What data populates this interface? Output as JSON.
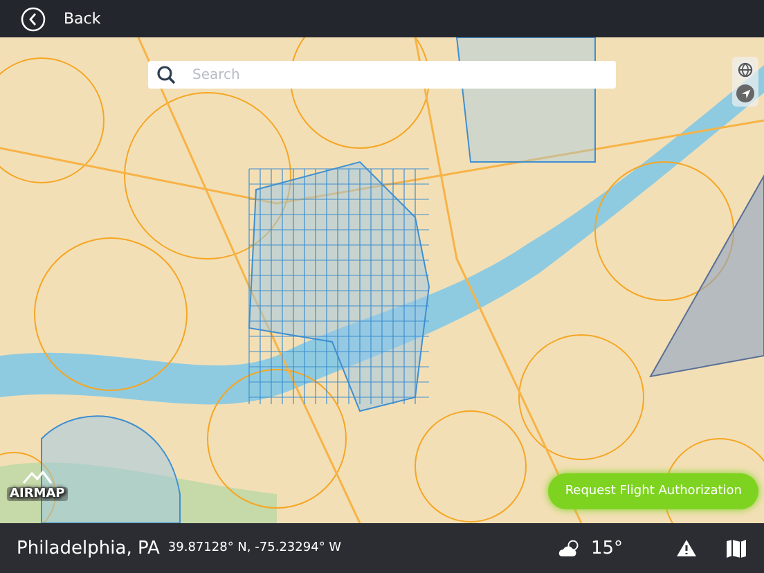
{
  "header": {
    "back_label": "Back"
  },
  "search": {
    "placeholder": "Search"
  },
  "logo": {
    "text": "AIRMAP"
  },
  "action_button": {
    "label": "Request Flight Authorization"
  },
  "status_bar": {
    "location": "Philadelphia, PA",
    "coordinates": "39.87128° N, -75.23294° W",
    "temperature": "15°"
  }
}
